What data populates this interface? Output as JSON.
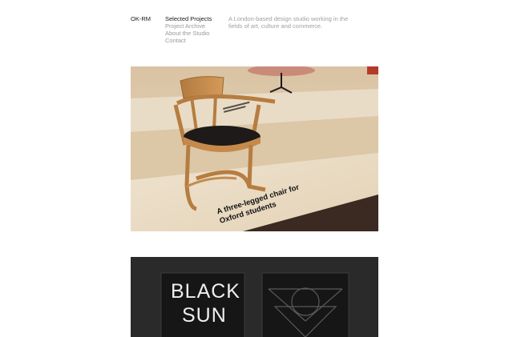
{
  "site": {
    "logo": "OK-RM",
    "tagline": "A London-based design studio working in the fields of art, culture and commerce."
  },
  "nav": {
    "items": [
      {
        "label": "Selected Projects",
        "active": true
      },
      {
        "label": "Project Archive",
        "active": false
      },
      {
        "label": "About the Studio",
        "active": false
      },
      {
        "label": "Contact",
        "active": false
      }
    ]
  },
  "projects": [
    {
      "caption_line1": "A three-legged chair for",
      "caption_line2": "Oxford students",
      "image_icon": "chair-photo"
    },
    {
      "book_title_line1": "BLACK",
      "book_title_line2": "SUN",
      "image_icon": "black-sun-book-photo"
    }
  ],
  "colors": {
    "text_active": "#1a1a1a",
    "text_muted": "#9a9a9a",
    "background": "#ffffff"
  }
}
